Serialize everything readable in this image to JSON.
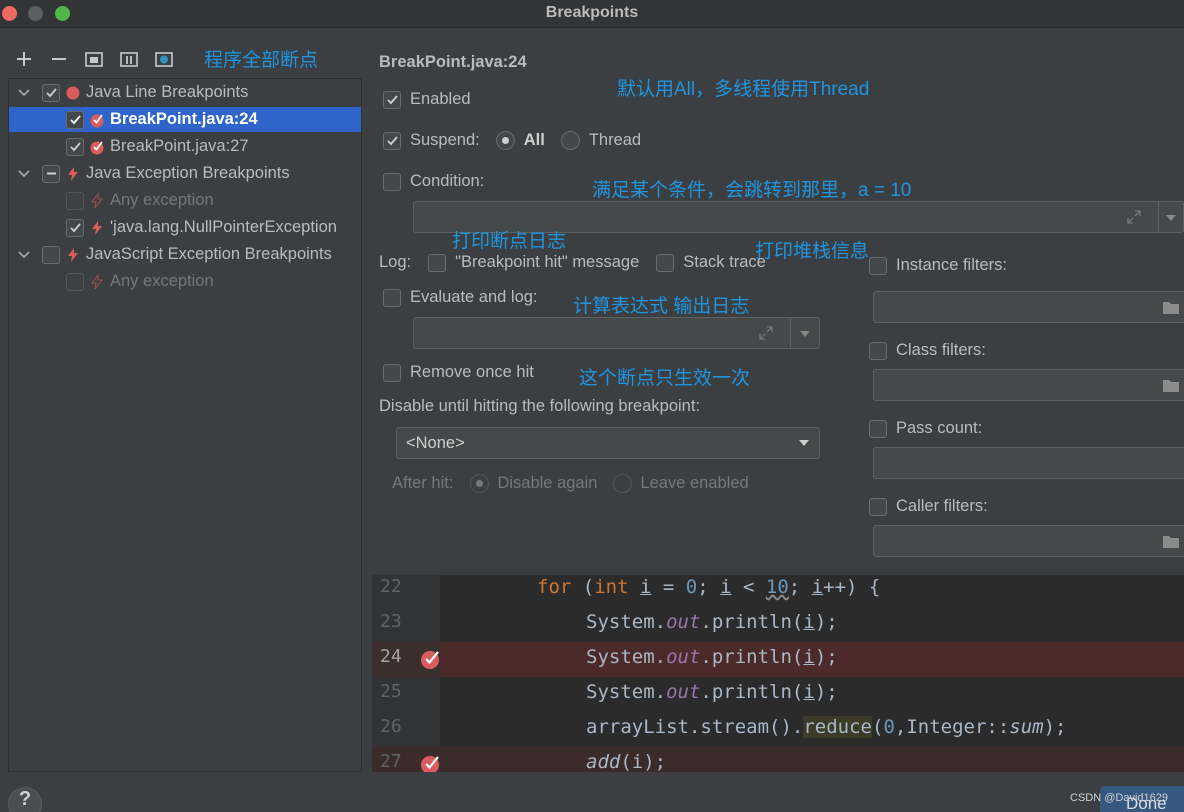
{
  "window": {
    "title": "Breakpoints"
  },
  "toolbar": {
    "annotation": "程序全部断点",
    "buttons": [
      "add-icon",
      "remove-icon",
      "group-by-package-icon",
      "group-by-class-icon",
      "group-by-file-icon"
    ]
  },
  "tree": {
    "items": [
      {
        "label": "Java Line Breakpoints",
        "checked": true,
        "expanded": true,
        "icon": "red-dot-icon"
      },
      {
        "label": "BreakPoint.java:24",
        "checked": true,
        "selected": true,
        "icon": "breakpoint-icon"
      },
      {
        "label": "BreakPoint.java:27",
        "checked": true,
        "icon": "breakpoint-icon"
      },
      {
        "label": "Java Exception Breakpoints",
        "checked": "partial",
        "expanded": true,
        "icon": "lightning-icon"
      },
      {
        "label": "Any exception",
        "checked": false,
        "disabled": true,
        "icon": "lightning-icon"
      },
      {
        "label": "'java.lang.NullPointerException",
        "checked": true,
        "icon": "lightning-icon"
      },
      {
        "label": "JavaScript Exception Breakpoints",
        "checked": false,
        "expanded": true,
        "icon": "lightning-icon"
      },
      {
        "label": "Any exception",
        "checked": false,
        "disabled": true,
        "icon": "lightning-icon"
      }
    ]
  },
  "details": {
    "title": "BreakPoint.java:24",
    "enabled": {
      "label": "Enabled",
      "checked": true
    },
    "suspend": {
      "label": "Suspend:",
      "checked": true,
      "option_all": "All",
      "option_thread": "Thread",
      "selected": "All"
    },
    "condition": {
      "label": "Condition:",
      "checked": false,
      "value": ""
    },
    "log": {
      "label": "Log:",
      "message": {
        "label": "\"Breakpoint hit\" message",
        "checked": false
      },
      "stack_trace": {
        "label": "Stack trace",
        "checked": false
      }
    },
    "evaluate": {
      "label": "Evaluate and log:",
      "checked": false,
      "value": ""
    },
    "remove_once": {
      "label": "Remove once hit",
      "checked": false
    },
    "disable_until": {
      "label": "Disable until hitting the following breakpoint:",
      "selected": "<None>"
    },
    "after_hit": {
      "label": "After hit:",
      "option_disable": "Disable again",
      "option_leave": "Leave enabled"
    },
    "filters": {
      "instance": "Instance filters:",
      "class": "Class filters:",
      "pass_count": "Pass count:",
      "caller": "Caller filters:"
    }
  },
  "annotations": {
    "suspend_note": "默认用All，多线程使用Thread",
    "condition_note": "满足某个条件，会跳转到那里，a = 10",
    "log_note": "打印断点日志",
    "stack_note": "打印堆栈信息",
    "evaluate_note": "计算表达式 输出日志",
    "remove_note": "这个断点只生效一次"
  },
  "code": {
    "lines": [
      {
        "num": "22",
        "breakpoint": false
      },
      {
        "num": "23",
        "breakpoint": false
      },
      {
        "num": "24",
        "breakpoint": true,
        "current": true
      },
      {
        "num": "25",
        "breakpoint": false
      },
      {
        "num": "26",
        "breakpoint": false
      },
      {
        "num": "27",
        "breakpoint": true
      }
    ],
    "tokens": {
      "for": "for",
      "int": "int",
      "i": "i",
      "eq": " = ",
      "zero": "0",
      "semi1": "; ",
      "lt": " < ",
      "ten": "10",
      "semi2": "; ",
      "inc": "++) {",
      "system": "System.",
      "out": "out",
      "println": ".println(",
      "close": ");",
      "arraylist": "arrayList.stream().",
      "reduce": "reduce",
      "reduce_args_a": "(",
      "reduce_zero": "0",
      "reduce_args_b": ",Integer::",
      "sum": "sum",
      "reduce_close": ");",
      "add": "add",
      "add_args": "(i);"
    }
  },
  "footer": {
    "help": "?",
    "done": "Done",
    "watermark": "CSDN @David1629"
  },
  "colors": {
    "selection": "#2f65ca",
    "annotation": "#1f95e0",
    "breakpoint": "#db5c5c"
  }
}
